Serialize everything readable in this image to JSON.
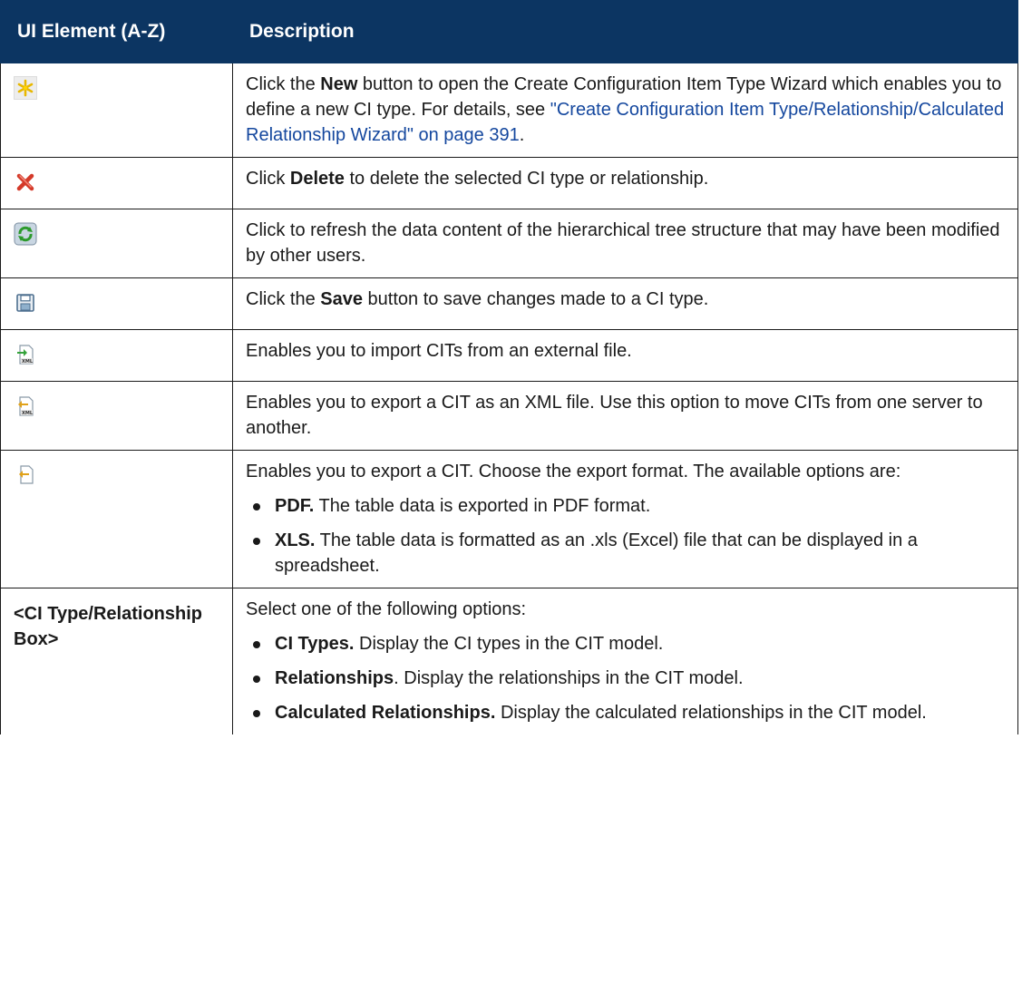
{
  "header": {
    "col1": "UI Element (A-Z)",
    "col2": "Description"
  },
  "rows": {
    "new": {
      "icon": "new-star-icon",
      "t1": "Click the ",
      "b1": "New",
      "t2": " button to open the Create Configuration Item Type Wizard which enables you to define a new CI type. For details, see ",
      "link": "\"Create Configuration Item Type/Relationship/Calculated Relationship Wizard\" on page 391",
      "t3": "."
    },
    "delete": {
      "icon": "delete-x-icon",
      "t1": "Click ",
      "b1": "Delete",
      "t2": " to delete the selected CI type or relationship."
    },
    "refresh": {
      "icon": "refresh-icon",
      "text": "Click to refresh the data content of the hierarchical tree structure that may have been modified by other users."
    },
    "save": {
      "icon": "save-floppy-icon",
      "t1": "Click the ",
      "b1": "Save",
      "t2": " button to save changes made to a CI type."
    },
    "import": {
      "icon": "import-xml-icon",
      "text": "Enables you to import CITs from an external file."
    },
    "export_xml": {
      "icon": "export-xml-icon",
      "text": "Enables you to export a CIT as an XML file. Use this option to move CITs from one server to another."
    },
    "export": {
      "icon": "export-icon",
      "text": "Enables you to export a CIT. Choose the export format. The available options are:",
      "items": [
        {
          "b": "PDF.",
          "t": " The table data is exported in PDF format."
        },
        {
          "b": "XLS.",
          "t": " The table data is formatted as an .xls (Excel) file that can be displayed in a spreadsheet."
        }
      ]
    },
    "box": {
      "label": "<CI Type/Relationship Box>",
      "text": "Select one of the following options:",
      "items": [
        {
          "b": "CI Types.",
          "t": " Display the CI types in the CIT model."
        },
        {
          "b": "Relationships",
          "t": ". Display the relationships in the CIT model."
        },
        {
          "b": "Calculated Relationships.",
          "t": " Display the calculated relationships in the CIT model."
        }
      ]
    }
  }
}
